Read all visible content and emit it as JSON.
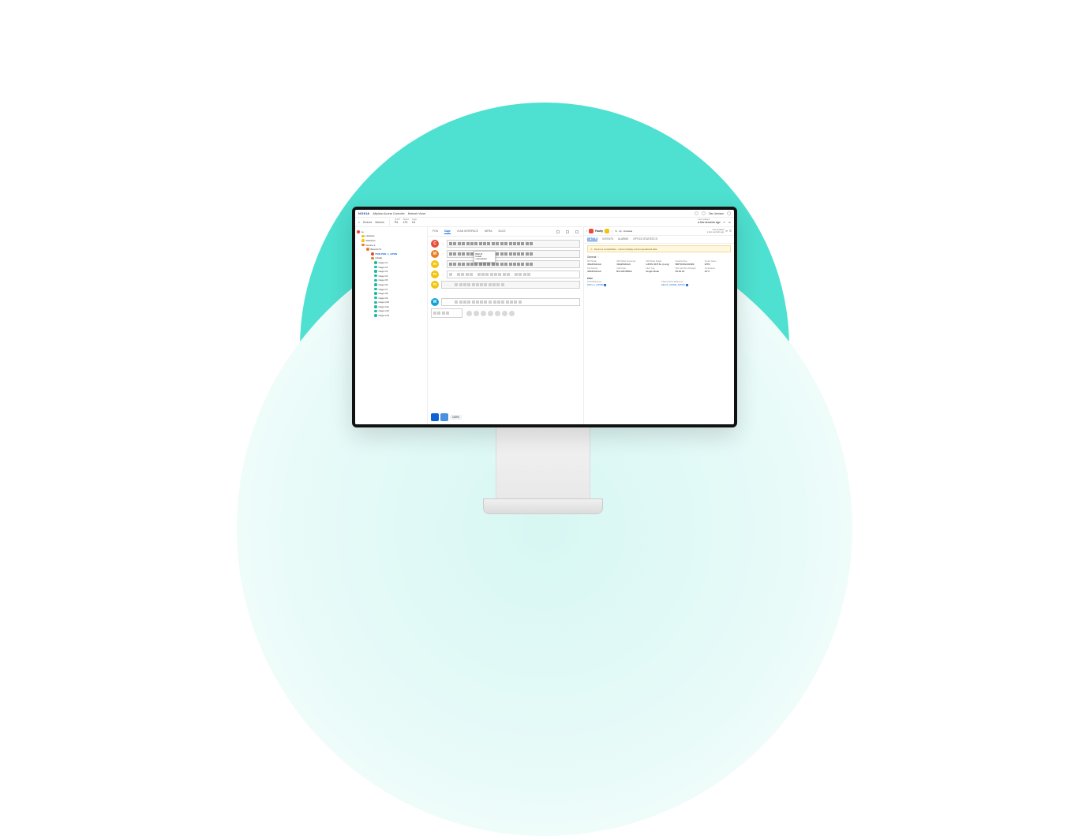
{
  "brand": "NOKIA",
  "app_title": "Altiplano Access Controller",
  "breadcrumb": "Network Views",
  "user": {
    "name": "Den Johnson"
  },
  "toolbar": {
    "devices_label": "Devices",
    "network_label": "Network",
    "lt_lbl": "LT/NT",
    "lt_val": "P4",
    "board_lbl": "Board",
    "board_val": "LT1",
    "cage_lbl": "Cage",
    "cage_val": "C1"
  },
  "tree": {
    "root": "ne",
    "nodes": [
      {
        "cls": "b-yel",
        "lbl": "Hotdocs",
        "ind": 1
      },
      {
        "cls": "b-yel",
        "lbl": "Switches",
        "ind": 1
      },
      {
        "cls": "b-ora",
        "lbl": "Device-1",
        "ind": 1
      },
      {
        "cls": "b-ora",
        "lbl": "Board LT1",
        "ind": 2
      },
      {
        "cls": "b-red",
        "lbl": "PON PON_1_GPON",
        "ind": 3,
        "sel": true
      },
      {
        "cls": "b-ora",
        "lbl": "CAGE",
        "ind": 3
      },
      {
        "cls": "b-grn",
        "lbl": "Cage C1",
        "ind": 4
      },
      {
        "cls": "b-grn",
        "lbl": "Cage C2",
        "ind": 4
      },
      {
        "cls": "b-grn",
        "lbl": "Cage C3",
        "ind": 4
      },
      {
        "cls": "b-grn",
        "lbl": "Cage C4",
        "ind": 4
      },
      {
        "cls": "b-grn",
        "lbl": "Cage C5",
        "ind": 4
      },
      {
        "cls": "b-grn",
        "lbl": "Cage C6",
        "ind": 4
      },
      {
        "cls": "b-grn",
        "lbl": "Cage C7",
        "ind": 4
      },
      {
        "cls": "b-grn",
        "lbl": "Cage C8",
        "ind": 4
      },
      {
        "cls": "b-grn",
        "lbl": "Cage C9",
        "ind": 4
      },
      {
        "cls": "b-grn",
        "lbl": "Cage C10",
        "ind": 4
      },
      {
        "cls": "b-grn",
        "lbl": "Cage C11",
        "ind": 4
      },
      {
        "cls": "b-grn",
        "lbl": "Cage C12",
        "ind": 4
      },
      {
        "cls": "b-grn",
        "lbl": "Cage C13",
        "ind": 4
      }
    ]
  },
  "center_tabs": [
    "PON",
    "Cage",
    "VLAN INTERFACE",
    "INFRA",
    "SLICE"
  ],
  "center_active_tab": "Cage",
  "rack_rows": [
    {
      "badge": "C",
      "cls": "rd-C",
      "dots": true,
      "groups": [
        4,
        8,
        8
      ]
    },
    {
      "badge": "M",
      "cls": "rd-M",
      "dots": true,
      "groups": [
        4,
        8,
        8
      ],
      "hover": true
    },
    {
      "badge": "m",
      "cls": "rd-m",
      "dots": true,
      "groups": [
        4,
        8,
        8
      ]
    },
    {
      "badge": "m",
      "cls": "rd-m",
      "dots": true,
      "groups": [
        1,
        4,
        8,
        4
      ],
      "split": true,
      "outline": true
    },
    {
      "badge": "m",
      "cls": "rd-m",
      "dots": false,
      "label": "· · · · ·",
      "empty": true
    },
    {
      "badge": "",
      "cls": "",
      "spacer": true
    },
    {
      "badge": "W",
      "cls": "rd-W",
      "dots": false,
      "label": "· · · · ·",
      "groups": [
        8,
        8
      ],
      "outline": true
    }
  ],
  "hover": {
    "title": "Port 3",
    "line1": "Details",
    "line2": "• Description"
  },
  "zoom": "100%",
  "right": {
    "badge": "Faulty",
    "updated_lbl": "Last updated",
    "updated_val": "a few seconds ago",
    "unlocked": "Unlocked",
    "status_off": "Off",
    "status_up": "Up",
    "tabs": [
      "DETAILS",
      "INTENTS",
      "ALARMS",
      "OPTICS STATISTICS"
    ],
    "active_tab": "DETAILS",
    "warn": "Device is unreachable – Cannot display current operational data",
    "section": "General",
    "kv": [
      {
        "k": "SFP Model",
        "v": "3FE25441AA"
      },
      {
        "k": "SFP Model Connected",
        "v": "3FE25441AC"
      },
      {
        "k": "SFP Model Details",
        "v": "GPON SFP B+ (Long)"
      },
      {
        "k": "Serial Number",
        "v": "BMT0C81C01682"
      },
      {
        "k": "Vendor Name",
        "v": "WTD"
      },
      {
        "k": "Part Number",
        "v": "3FE25441AC"
      },
      {
        "k": "CLEI Code",
        "v": "BVL3ANPBAA"
      },
      {
        "k": "Fiber Type",
        "v": "Single Mode"
      },
      {
        "k": "SFP Last Time Changed",
        "v": "09:36:32"
      },
      {
        "k": "Temperature",
        "v": "42°C"
      }
    ],
    "pon_header": "PON",
    "refs": [
      {
        "k": "PON Reference",
        "v": "PON_1_GPON"
      },
      {
        "k": "Channel Pair Reference",
        "v": "Fiber1_CPAIR_GPON"
      }
    ]
  }
}
